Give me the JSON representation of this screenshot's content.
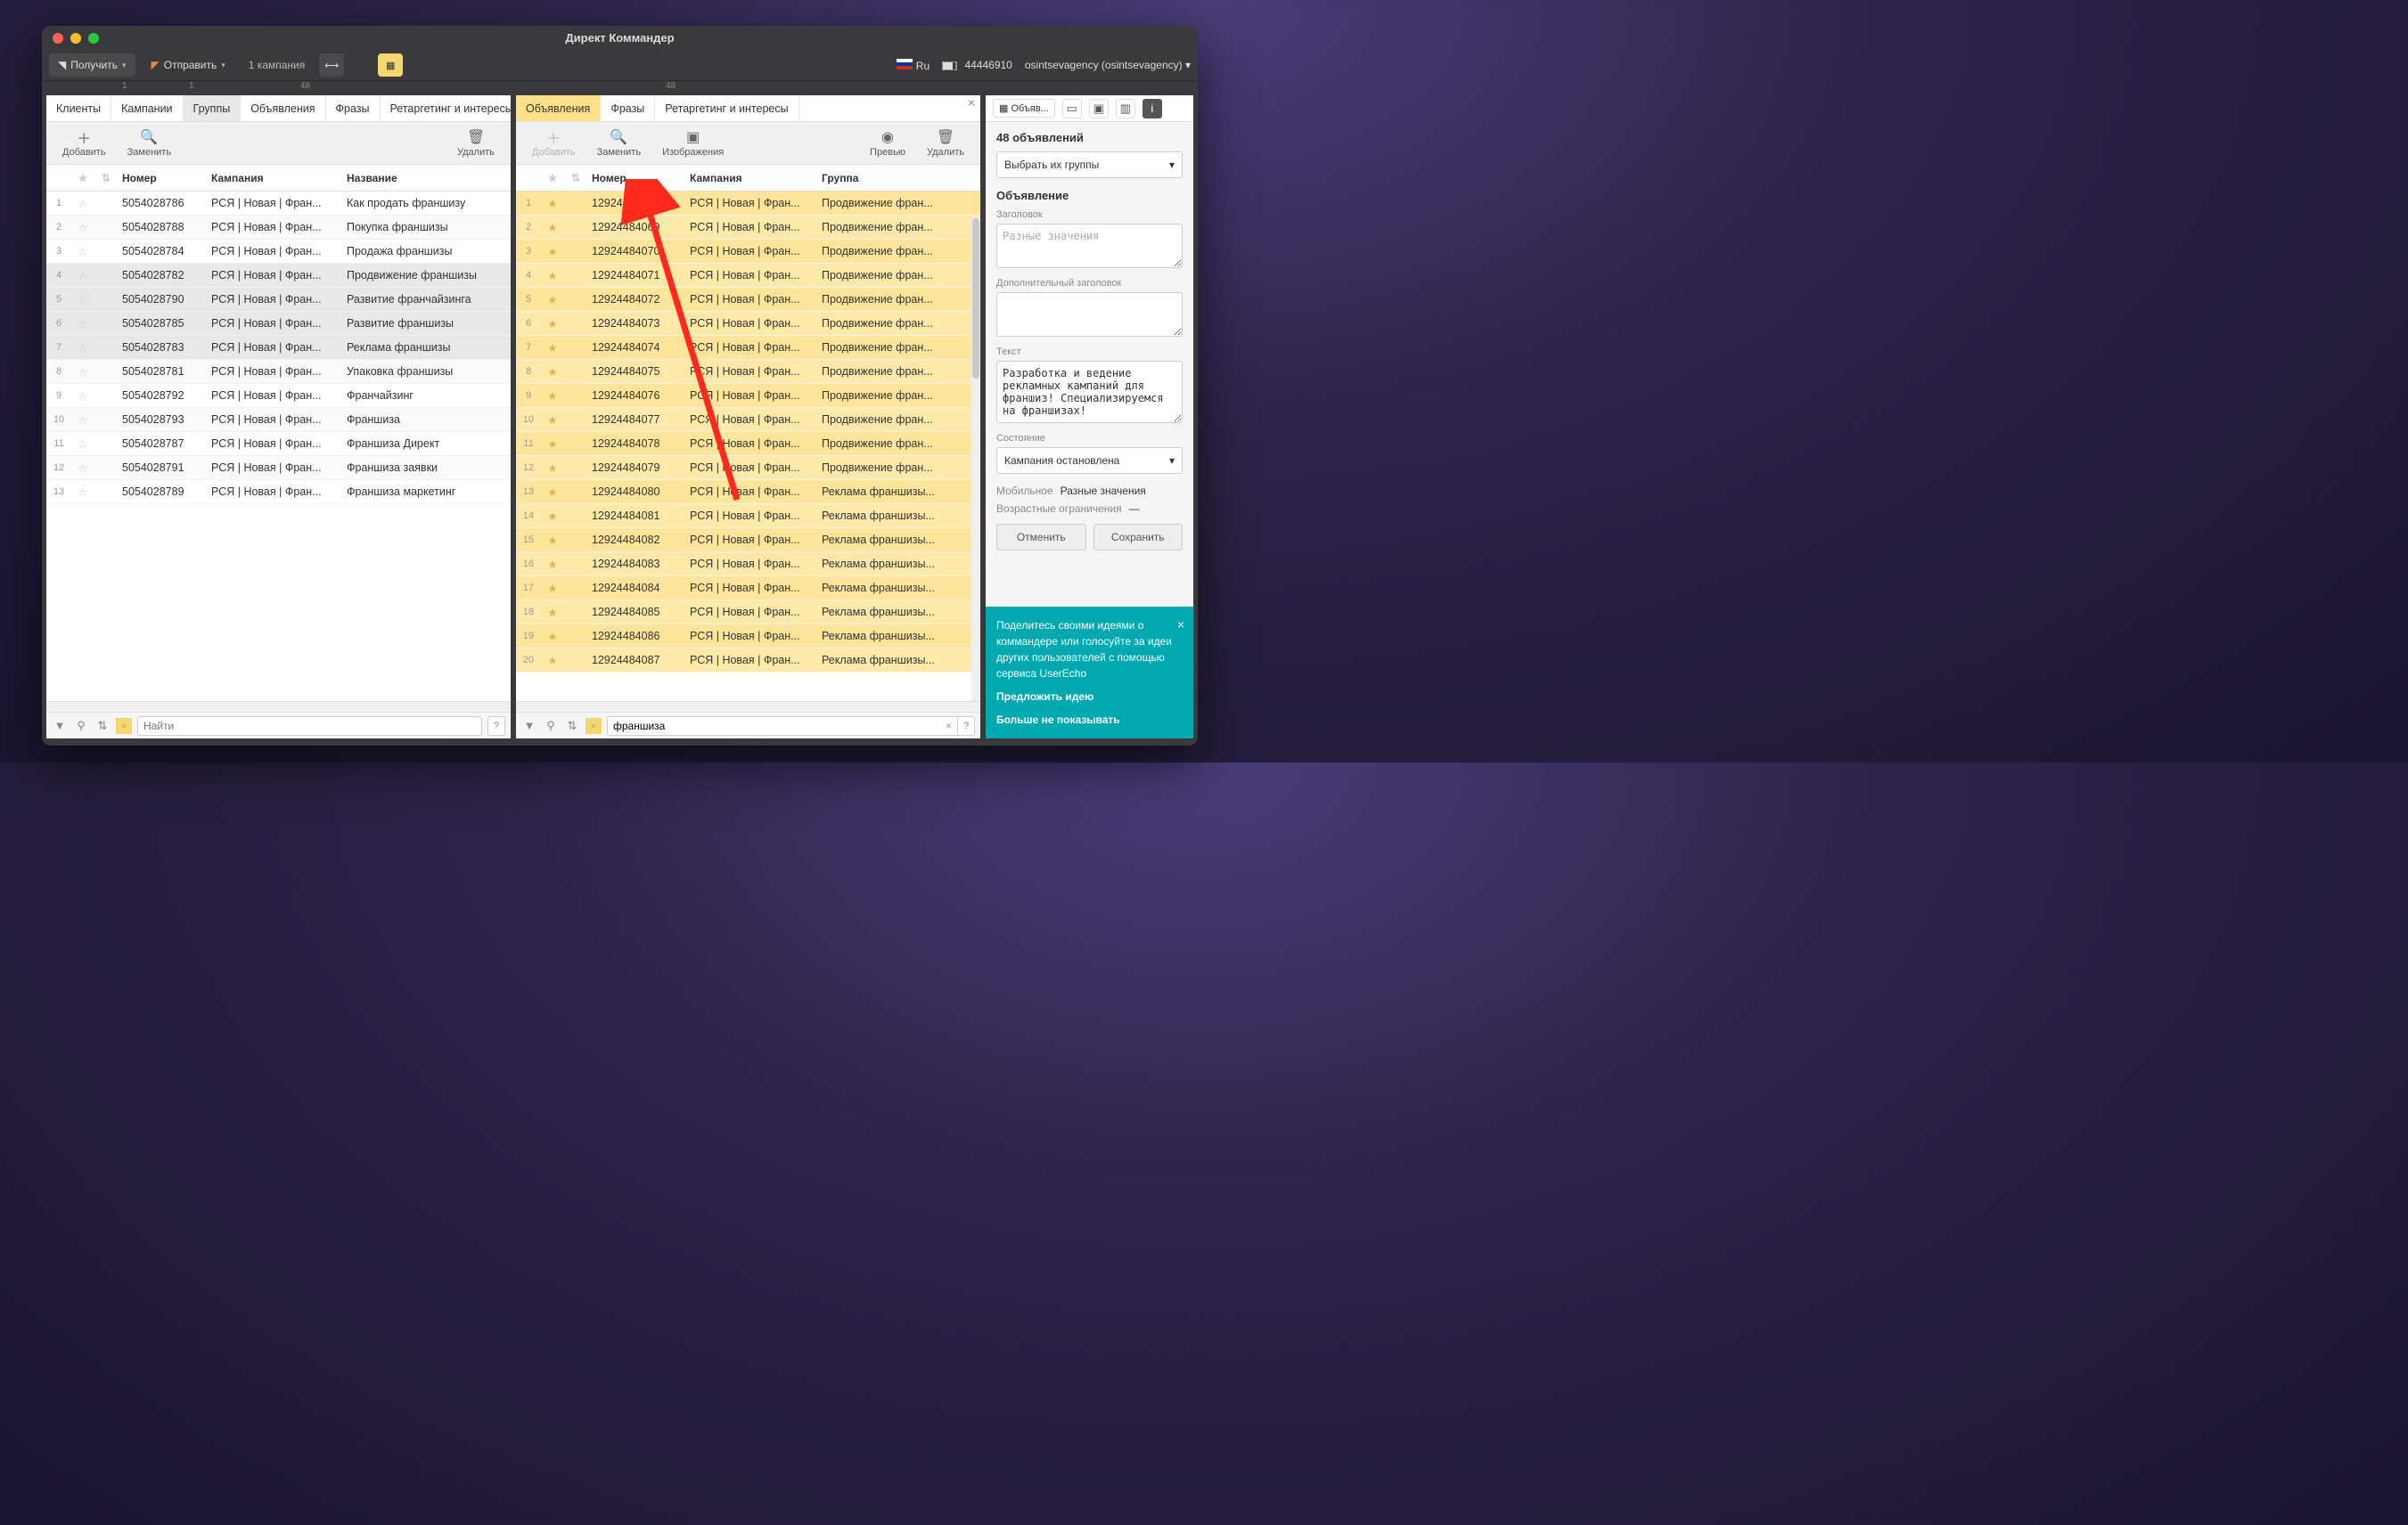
{
  "window_title": "Директ Коммандер",
  "topbar": {
    "receive": "Получить",
    "send": "Отправить",
    "campaign_count": "1 кампания",
    "lang": "Ru",
    "account_id": "44446910",
    "user": "osintsevagency (osintsevagency)"
  },
  "ruler_left": {
    "t1": "1",
    "t2": "1",
    "t48": "48"
  },
  "ruler_mid": {
    "t48": "48"
  },
  "left_panel": {
    "tabs": [
      "Клиенты",
      "Кампании",
      "Группы",
      "Объявления",
      "Фразы",
      "Ретаргетинг и интересы"
    ],
    "active_tab": 2,
    "tools": {
      "add": "Добавить",
      "replace": "Заменить",
      "delete": "Удалить"
    },
    "headers": {
      "number": "Номер",
      "campaign": "Кампания",
      "name": "Название"
    },
    "rows": [
      {
        "i": "1",
        "num": "5054028786",
        "camp": "РСЯ | Новая | Фран...",
        "name": "Как продать франшизу"
      },
      {
        "i": "2",
        "num": "5054028788",
        "camp": "РСЯ | Новая | Фран...",
        "name": "Покупка франшизы"
      },
      {
        "i": "3",
        "num": "5054028784",
        "camp": "РСЯ | Новая | Фран...",
        "name": "Продажа франшизы"
      },
      {
        "i": "4",
        "num": "5054028782",
        "camp": "РСЯ | Новая | Фран...",
        "name": "Продвижение франшизы",
        "sel": true
      },
      {
        "i": "5",
        "num": "5054028790",
        "camp": "РСЯ | Новая | Фран...",
        "name": "Развитие франчайзинга",
        "sel": true
      },
      {
        "i": "6",
        "num": "5054028785",
        "camp": "РСЯ | Новая | Фран...",
        "name": "Развитие франшизы",
        "sel": true
      },
      {
        "i": "7",
        "num": "5054028783",
        "camp": "РСЯ | Новая | Фран...",
        "name": "Реклама франшизы",
        "sel": true
      },
      {
        "i": "8",
        "num": "5054028781",
        "camp": "РСЯ | Новая | Фран...",
        "name": "Упаковка франшизы"
      },
      {
        "i": "9",
        "num": "5054028792",
        "camp": "РСЯ | Новая | Фран...",
        "name": "Франчайзинг"
      },
      {
        "i": "10",
        "num": "5054028793",
        "camp": "РСЯ | Новая | Фран...",
        "name": "Франшиза"
      },
      {
        "i": "11",
        "num": "5054028787",
        "camp": "РСЯ | Новая | Фран...",
        "name": "Франшиза Директ"
      },
      {
        "i": "12",
        "num": "5054028791",
        "camp": "РСЯ | Новая | Фран...",
        "name": "Франшиза заявки"
      },
      {
        "i": "13",
        "num": "5054028789",
        "camp": "РСЯ | Новая | Фран...",
        "name": "Франшиза маркетинг"
      }
    ],
    "search_placeholder": "Найти"
  },
  "mid_panel": {
    "tabs": [
      "Объявления",
      "Фразы",
      "Ретаргетинг и интересы"
    ],
    "active_tab": 0,
    "tools": {
      "add": "Добавить",
      "replace": "Заменить",
      "images": "Изображения",
      "preview": "Превью",
      "delete": "Удалить"
    },
    "headers": {
      "number": "Номер",
      "campaign": "Кампания",
      "group": "Группа"
    },
    "rows": [
      {
        "i": "1",
        "num": "12924484068",
        "camp": "РСЯ | Новая | Фран...",
        "grp": "Продвижение фран..."
      },
      {
        "i": "2",
        "num": "12924484069",
        "camp": "РСЯ | Новая | Фран...",
        "grp": "Продвижение фран..."
      },
      {
        "i": "3",
        "num": "12924484070",
        "camp": "РСЯ | Новая | Фран...",
        "grp": "Продвижение фран..."
      },
      {
        "i": "4",
        "num": "12924484071",
        "camp": "РСЯ | Новая | Фран...",
        "grp": "Продвижение фран..."
      },
      {
        "i": "5",
        "num": "12924484072",
        "camp": "РСЯ | Новая | Фран...",
        "grp": "Продвижение фран..."
      },
      {
        "i": "6",
        "num": "12924484073",
        "camp": "РСЯ | Новая | Фран...",
        "grp": "Продвижение фран..."
      },
      {
        "i": "7",
        "num": "12924484074",
        "camp": "РСЯ | Новая | Фран...",
        "grp": "Продвижение фран..."
      },
      {
        "i": "8",
        "num": "12924484075",
        "camp": "РСЯ | Новая | Фран...",
        "grp": "Продвижение фран..."
      },
      {
        "i": "9",
        "num": "12924484076",
        "camp": "РСЯ | Новая | Фран...",
        "grp": "Продвижение фран..."
      },
      {
        "i": "10",
        "num": "12924484077",
        "camp": "РСЯ | Новая | Фран...",
        "grp": "Продвижение фран..."
      },
      {
        "i": "11",
        "num": "12924484078",
        "camp": "РСЯ | Новая | Фран...",
        "grp": "Продвижение фран..."
      },
      {
        "i": "12",
        "num": "12924484079",
        "camp": "РСЯ | Новая | Фран...",
        "grp": "Продвижение фран..."
      },
      {
        "i": "13",
        "num": "12924484080",
        "camp": "РСЯ | Новая | Фран...",
        "grp": "Реклама франшизы..."
      },
      {
        "i": "14",
        "num": "12924484081",
        "camp": "РСЯ | Новая | Фран...",
        "grp": "Реклама франшизы..."
      },
      {
        "i": "15",
        "num": "12924484082",
        "camp": "РСЯ | Новая | Фран...",
        "grp": "Реклама франшизы..."
      },
      {
        "i": "16",
        "num": "12924484083",
        "camp": "РСЯ | Новая | Фран...",
        "grp": "Реклама франшизы..."
      },
      {
        "i": "17",
        "num": "12924484084",
        "camp": "РСЯ | Новая | Фран...",
        "grp": "Реклама франшизы..."
      },
      {
        "i": "18",
        "num": "12924484085",
        "camp": "РСЯ | Новая | Фран...",
        "grp": "Реклама франшизы..."
      },
      {
        "i": "19",
        "num": "12924484086",
        "camp": "РСЯ | Новая | Фран...",
        "grp": "Реклама франшизы..."
      },
      {
        "i": "20",
        "num": "12924484087",
        "camp": "РСЯ | Новая | Фран...",
        "grp": "Реклама франшизы..."
      }
    ],
    "search_value": "франшиза"
  },
  "right_panel": {
    "tab_label": "Объяв...",
    "count_label": "48 объявлений",
    "select_label": "Выбрать их группы",
    "section_title": "Объявление",
    "lbl_headline": "Заголовок",
    "headline_value": "Разные значения",
    "lbl_headline2": "Дополнительный заголовок",
    "lbl_text": "Текст",
    "text_value": "Разработка и ведение рекламных кампаний для франшиз! Специализируемся на франшизах!",
    "lbl_state": "Состояние",
    "state_value": "Кампания остановлена",
    "lbl_mobile": "Мобильное",
    "mobile_value": "Разные значения",
    "lbl_age": "Возрастные ограничения",
    "age_value": "—",
    "btn_cancel": "Отменить",
    "btn_save": "Сохранить",
    "userecho_text": "Поделитесь своими идеями о коммандере или голосуйте за идеи других пользователей с помощью сервиса UserEcho",
    "userecho_suggest": "Предложить идею",
    "userecho_hide": "Больше не показывать"
  }
}
